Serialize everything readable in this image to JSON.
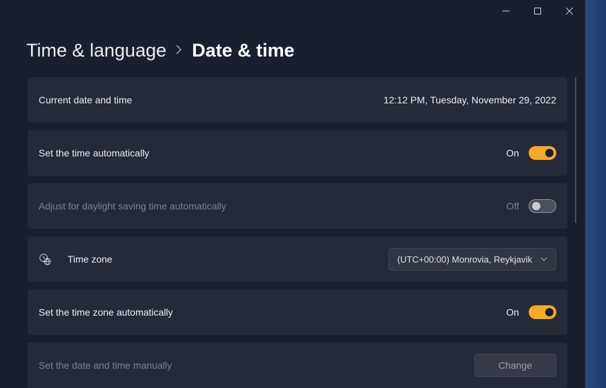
{
  "window_controls": {
    "minimize": "minimize",
    "maximize": "maximize",
    "close": "close"
  },
  "breadcrumb": {
    "parent": "Time & language",
    "current": "Date & time"
  },
  "rows": {
    "current": {
      "label": "Current date and time",
      "value": "12:12 PM, Tuesday, November 29, 2022"
    },
    "auto_time": {
      "label": "Set the time automatically",
      "state": "On"
    },
    "dst": {
      "label": "Adjust for daylight saving time automatically",
      "state": "Off"
    },
    "timezone": {
      "label": "Time zone",
      "value": "(UTC+00:00) Monrovia, Reykjavik"
    },
    "auto_tz": {
      "label": "Set the time zone automatically",
      "state": "On"
    },
    "manual": {
      "label": "Set the date and time manually",
      "button": "Change"
    }
  }
}
